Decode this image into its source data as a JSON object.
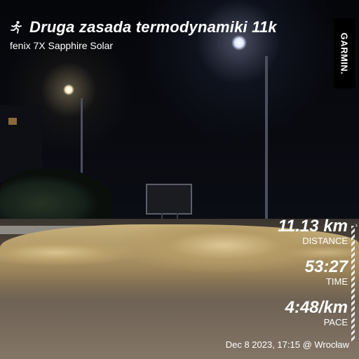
{
  "header": {
    "activity_icon": "running-person-icon",
    "title": "Druga zasada termodynamiki 11k",
    "device": "fenix 7X Sapphire Solar"
  },
  "brand": {
    "logo_text": "GARMIN."
  },
  "stats": [
    {
      "value": "11.13 km",
      "label": "DISTANCE"
    },
    {
      "value": "53:27",
      "label": "TIME"
    },
    {
      "value": "4:48/km",
      "label": "PACE"
    }
  ],
  "footer": {
    "date_location": "Dec 8 2023, 17:15 @ Wrocław"
  },
  "colors": {
    "text": "#ffffff",
    "logo_bg": "#000000"
  }
}
